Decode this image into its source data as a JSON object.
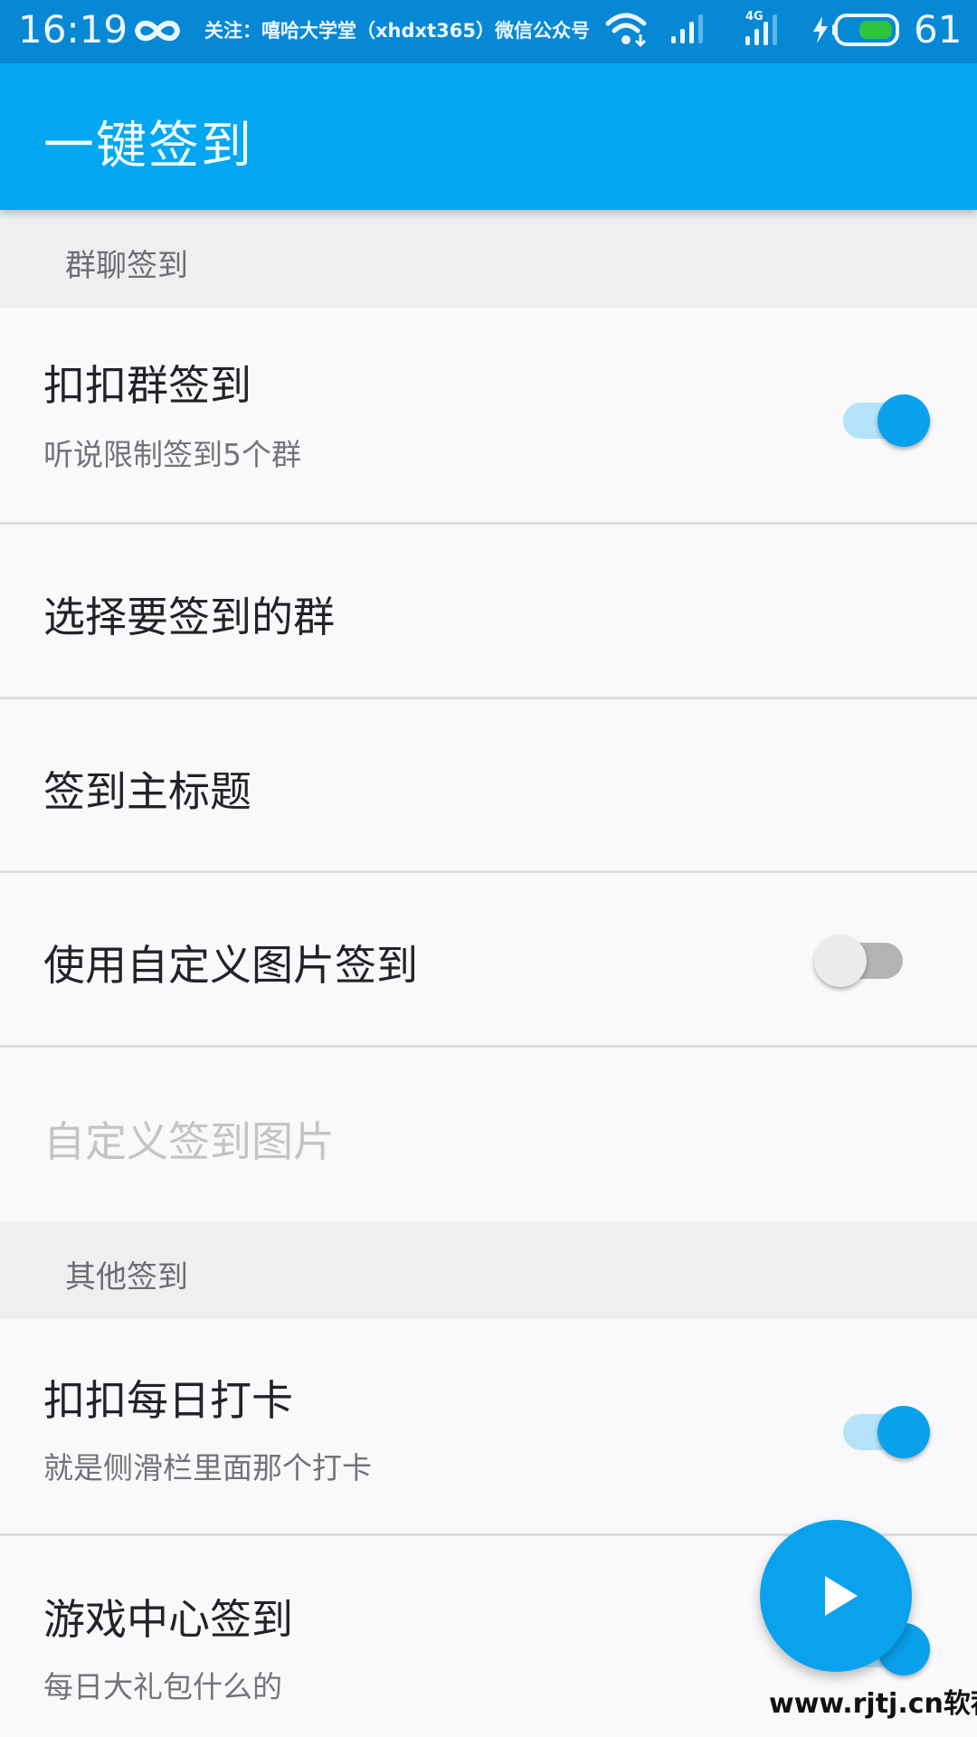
{
  "status_bar": {
    "time": "16:19",
    "notice": "关注：嘻哈大学堂（xhdxt365）微信公众号",
    "network_label": "4G",
    "battery_level": "61",
    "battery_fill_percent": 61,
    "icons": [
      "infinity-icon",
      "wifi-icon",
      "signal-icon",
      "signal-4g-icon",
      "charging-icon",
      "battery-icon"
    ]
  },
  "app_bar": {
    "title": "一键签到"
  },
  "sections": [
    {
      "header": "群聊签到",
      "items": [
        {
          "title": "扣扣群签到",
          "subtitle": "听说限制签到5个群",
          "toggle": true,
          "enabled": true
        },
        {
          "title": "选择要签到的群",
          "enabled": true
        },
        {
          "title": "签到主标题",
          "enabled": true
        },
        {
          "title": "使用自定义图片签到",
          "toggle": false,
          "enabled": true
        },
        {
          "title": "自定义签到图片",
          "enabled": false
        }
      ]
    },
    {
      "header": "其他签到",
      "items": [
        {
          "title": "扣扣每日打卡",
          "subtitle": "就是侧滑栏里面那个打卡",
          "toggle": true,
          "enabled": true
        },
        {
          "title": "游戏中心签到",
          "subtitle": "每日大礼包什么的",
          "toggle": true,
          "enabled": true
        }
      ]
    }
  ],
  "fab": {
    "icon": "play-icon"
  },
  "watermark": "www.rjtj.cn软荐网",
  "colors": {
    "status_bar": "#0788d4",
    "app_bar": "#03a6f0",
    "accent": "#0aa1ec",
    "section_bg": "#efeef1",
    "list_bg": "#f9f8fb"
  }
}
